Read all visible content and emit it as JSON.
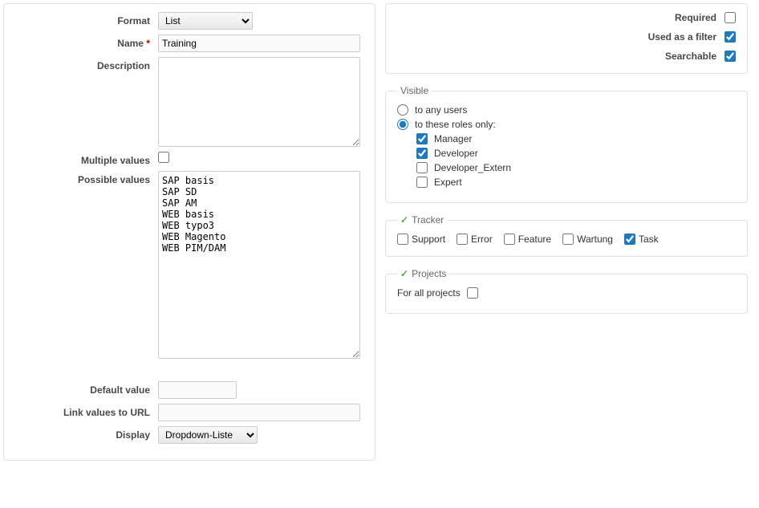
{
  "left": {
    "format_label": "Format",
    "format_value": "List",
    "name_label": "Name",
    "name_value": "Training",
    "description_label": "Description",
    "description_value": "",
    "multiple_label": "Multiple values",
    "multiple_checked": false,
    "possible_label": "Possible values",
    "possible_value": "SAP basis\nSAP SD\nSAP AM\nWEB basis\nWEB typo3\nWEB Magento\nWEB PIM/DAM",
    "default_label": "Default value",
    "default_value": "",
    "link_label": "Link values to URL",
    "link_value": "",
    "display_label": "Display",
    "display_value": "Dropdown-Liste"
  },
  "right": {
    "required_label": "Required",
    "required_checked": false,
    "filter_label": "Used as a filter",
    "filter_checked": true,
    "searchable_label": "Searchable",
    "searchable_checked": true
  },
  "visible": {
    "legend": "Visible",
    "any_label": "to any users",
    "any_selected": false,
    "roles_label": "to these roles only:",
    "roles_selected": true,
    "roles": [
      {
        "label": "Manager",
        "checked": true
      },
      {
        "label": "Developer",
        "checked": true
      },
      {
        "label": "Developer_Extern",
        "checked": false
      },
      {
        "label": "Expert",
        "checked": false
      }
    ]
  },
  "tracker": {
    "legend": "Tracker",
    "items": [
      {
        "label": "Support",
        "checked": false
      },
      {
        "label": "Error",
        "checked": false
      },
      {
        "label": "Feature",
        "checked": false
      },
      {
        "label": "Wartung",
        "checked": false
      },
      {
        "label": "Task",
        "checked": true
      }
    ]
  },
  "projects": {
    "legend": "Projects",
    "all_label": "For all projects",
    "all_checked": false
  }
}
